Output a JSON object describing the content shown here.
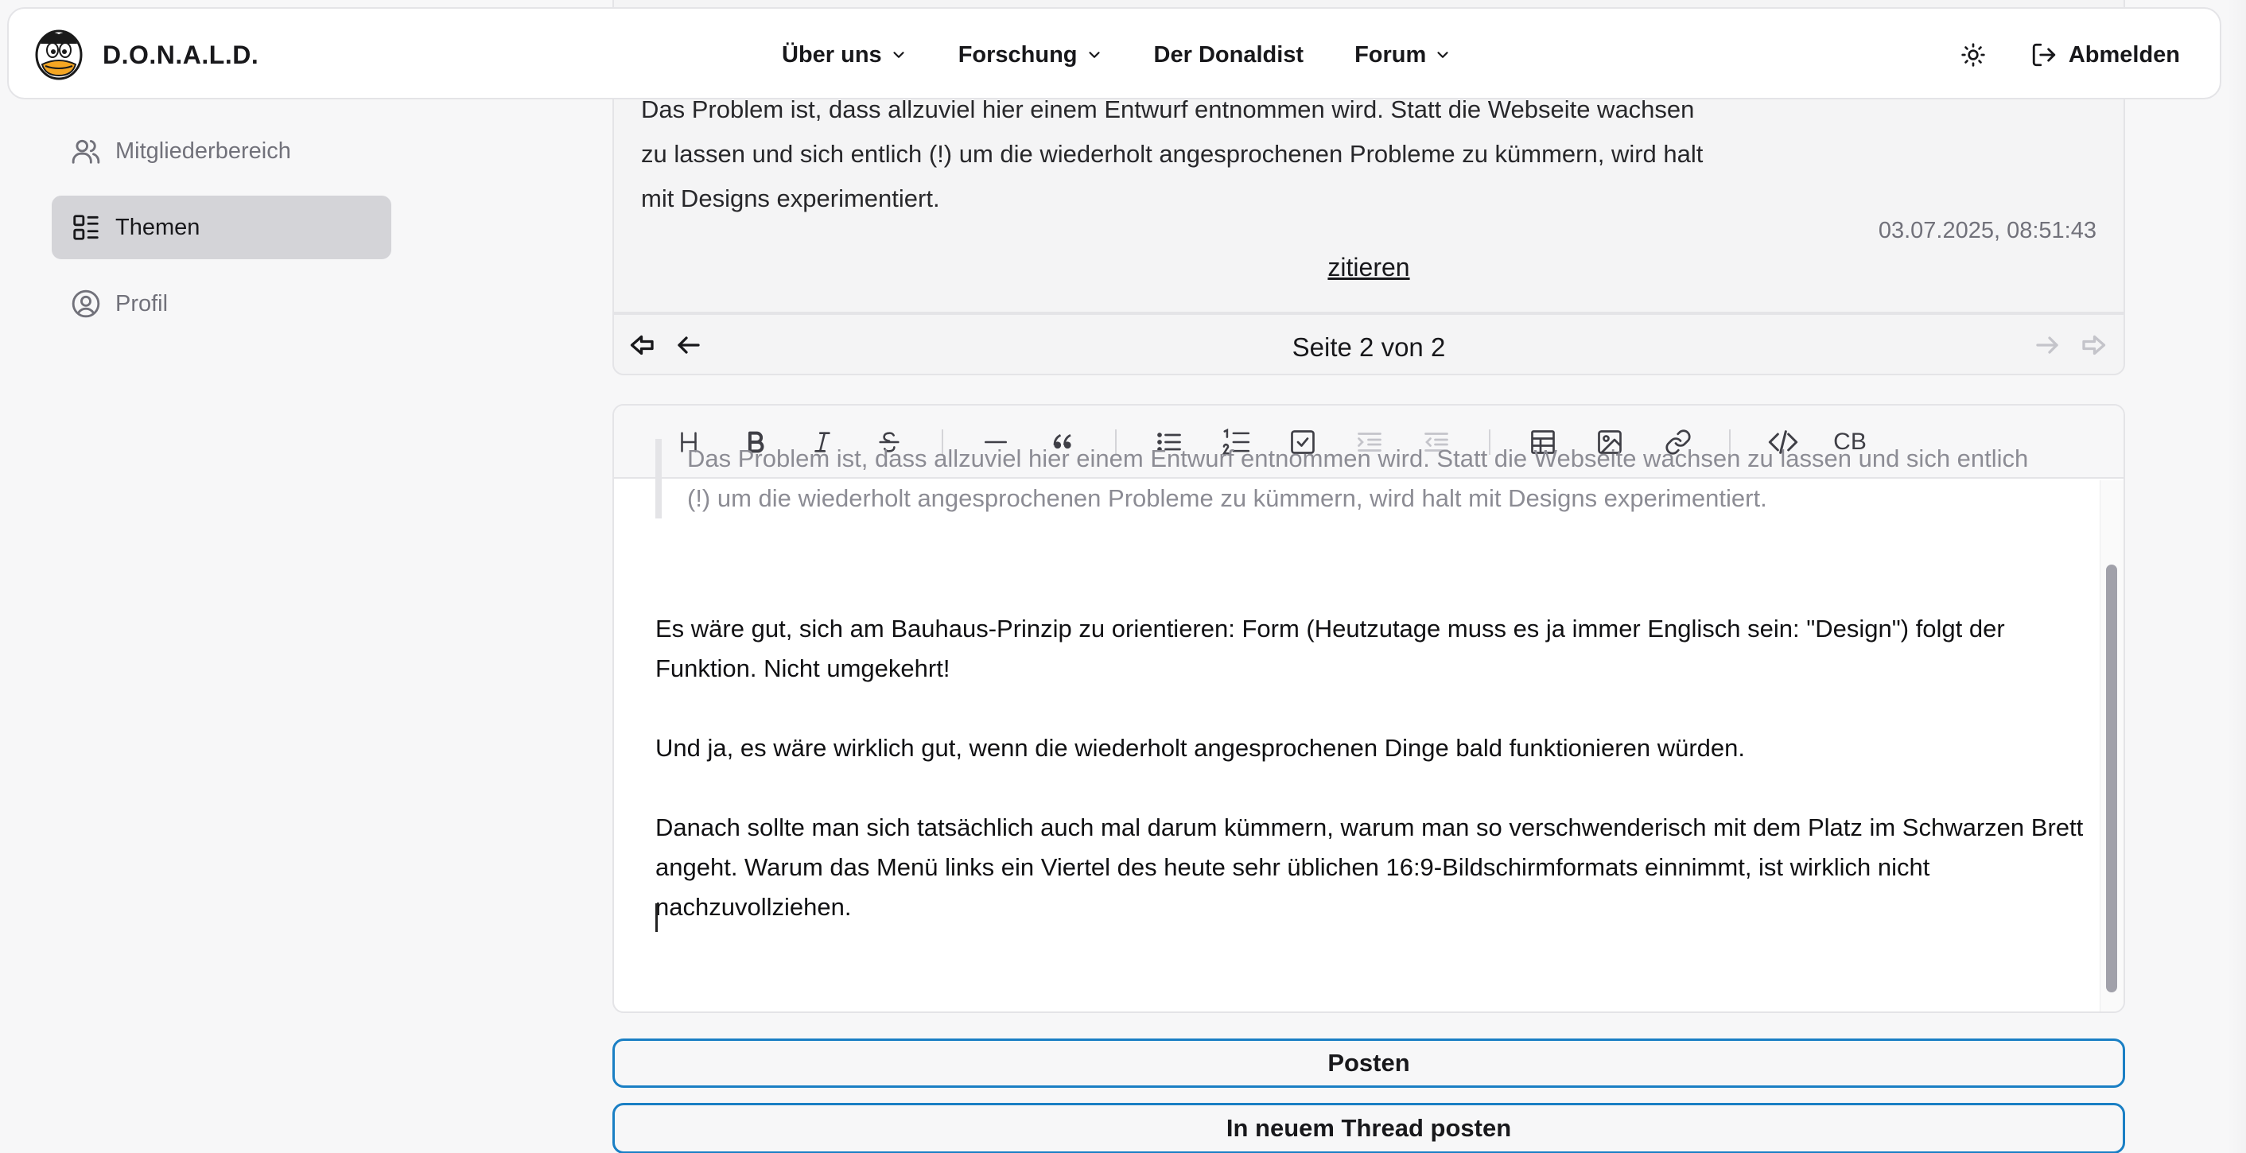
{
  "brand": {
    "name": "D.O.N.A.L.D."
  },
  "nav": {
    "items": [
      {
        "label": "Über uns",
        "dropdown": true
      },
      {
        "label": "Forschung",
        "dropdown": true
      },
      {
        "label": "Der Donaldist",
        "dropdown": false
      },
      {
        "label": "Forum",
        "dropdown": true
      }
    ],
    "theme_icon": "sun-icon",
    "logout_label": "Abmelden"
  },
  "sidebar": {
    "items": [
      {
        "label": "Mitgliederbereich",
        "icon": "users-icon",
        "active": false
      },
      {
        "label": "Themen",
        "icon": "list-icon",
        "active": true
      },
      {
        "label": "Profil",
        "icon": "user-circle-icon",
        "active": false
      }
    ]
  },
  "post": {
    "text": "Das Problem ist, dass allzuviel hier einem Entwurf entnommen wird. Statt die Webseite wachsen zu lassen und sich entlich (!) um die wiederholt angesprochenen Probleme zu kümmern, wird halt mit Designs experimentiert.",
    "date": "03.07.2025, 08:51:43",
    "quote_label": "zitieren"
  },
  "pagination": {
    "label": "Seite 2 von 2"
  },
  "editor": {
    "toolbar": [
      "heading",
      "bold",
      "italic",
      "strikethrough",
      "horizontal-rule",
      "quote",
      "bullet-list",
      "numbered-list",
      "task-list",
      "indent",
      "outdent",
      "table",
      "image",
      "link",
      "code",
      "codeblock"
    ],
    "codeblock_label": "CB",
    "quote_text": "Das Problem ist, dass allzuviel hier einem Entwurf entnommen wird. Statt die Webseite wachsen zu lassen und sich entlich (!) um die wiederholt angesprochenen Probleme zu kümmern, wird halt mit Designs experimentiert.",
    "paragraphs": [
      "Es wäre gut, sich am Bauhaus-Prinzip zu orientieren: Form (Heutzutage muss es  ja immer Englisch sein: \"Design\") folgt der Funktion. Nicht umgekehrt!",
      "Und ja, es wäre wirklich gut, wenn die wiederholt angesprochenen Dinge bald funktionieren würden.",
      "Danach sollte man sich tatsächlich auch mal darum kümmern, warum man so verschwenderisch mit dem Platz im Schwarzen Brett angeht. Warum das Menü links ein Viertel des heute sehr üblichen 16:9-Bildschirmformats einnimmt, ist wirklich nicht nachzuvollziehen."
    ]
  },
  "actions": {
    "post_label": "Posten",
    "new_thread_label": "In neuem Thread posten"
  },
  "colors": {
    "accent_border": "#1a7fc4",
    "active_sidebar": "#d4d4d8",
    "muted_text": "#71717a"
  }
}
